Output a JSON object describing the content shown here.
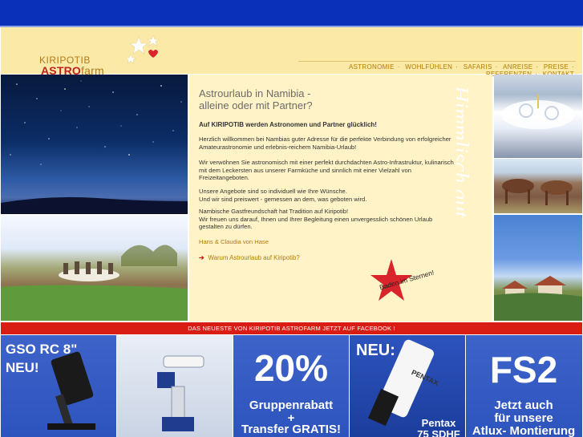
{
  "logo": {
    "line1": "KIRIPOTIB",
    "line2_astro": "ASTRO",
    "line2_farm": "farm"
  },
  "nav": {
    "items": [
      "ASTRONOMIE",
      "WOHLFÜHLEN",
      "SAFARIS",
      "ANREISE",
      "PREISE",
      "REFERENZEN",
      "KONTAKT"
    ],
    "separator": "·"
  },
  "content": {
    "heading_line1": "Astrourlaub in Namibia -",
    "heading_line2": "alleine oder mit Partner?",
    "lead": "Auf KIRIPOTIB werden Astronomen und Partner glücklich!",
    "para1": "Herzlich willkommen bei Nambias guter Adresse für die perfekte Verbindung von erfolgreicher Amateurastronomie und erlebnis-reichem Namibia-Urlaub!",
    "para2": "Wir verwöhnen Sie astronomisch mit einer perfekt durchdachten Astro-Infrastruktur, kulinarisch mit dem Leckersten aus unserer Farmküche und sinnlich mit einer Vielzahl von Freizeitangeboten.",
    "para3_line1": "Unsere Angebote sind so individuell wie Ihre Wünsche.",
    "para3_line2": "Und wir sind preiswert - gemessen an dem, was geboten wird.",
    "para4_line1": "Nambische Gastfreundschaft hat Tradition auf Kiripotib!",
    "para4_line2": "Wir freuen uns darauf, Ihnen und Ihrer Begleitung einen unvergesslich schönen Urlaub gestalten zu dürfen.",
    "signature": "Hans & Claudia von Hase",
    "why_link": "Warum Astrourlaub auf Kiripotib?",
    "vertical_text": "Himmlisch gut",
    "badge": "Baden im Sternen!"
  },
  "facebook_bar": "DAS NEUESTE VON KIRIPOTIB ASTROFARM JETZT AUF FACEBOOK !",
  "tiles": {
    "t1_line1": "GSO RC 8\"",
    "t1_line2": "NEU!",
    "t3_big": "20%",
    "t3_line1": "Gruppenrabatt",
    "t3_line2": "+",
    "t3_line3": "Transfer GRATIS!",
    "t4_neu": "NEU:",
    "t4_brand": "PENTAX",
    "t4_line1": "Pentax",
    "t4_line2": "75 SDHF",
    "t5_big": "FS2",
    "t5_line1": "Jetzt auch",
    "t5_line2": "für unsere",
    "t5_line3": "Atlux- Montierung"
  },
  "colors": {
    "top_bar": "#0a2fb8",
    "header_bg": "#fbe9a8",
    "content_bg": "#fff3c7",
    "accent_red": "#d91d15",
    "nav_gold": "#b27c00",
    "tile_blue": "#3e63c9"
  }
}
